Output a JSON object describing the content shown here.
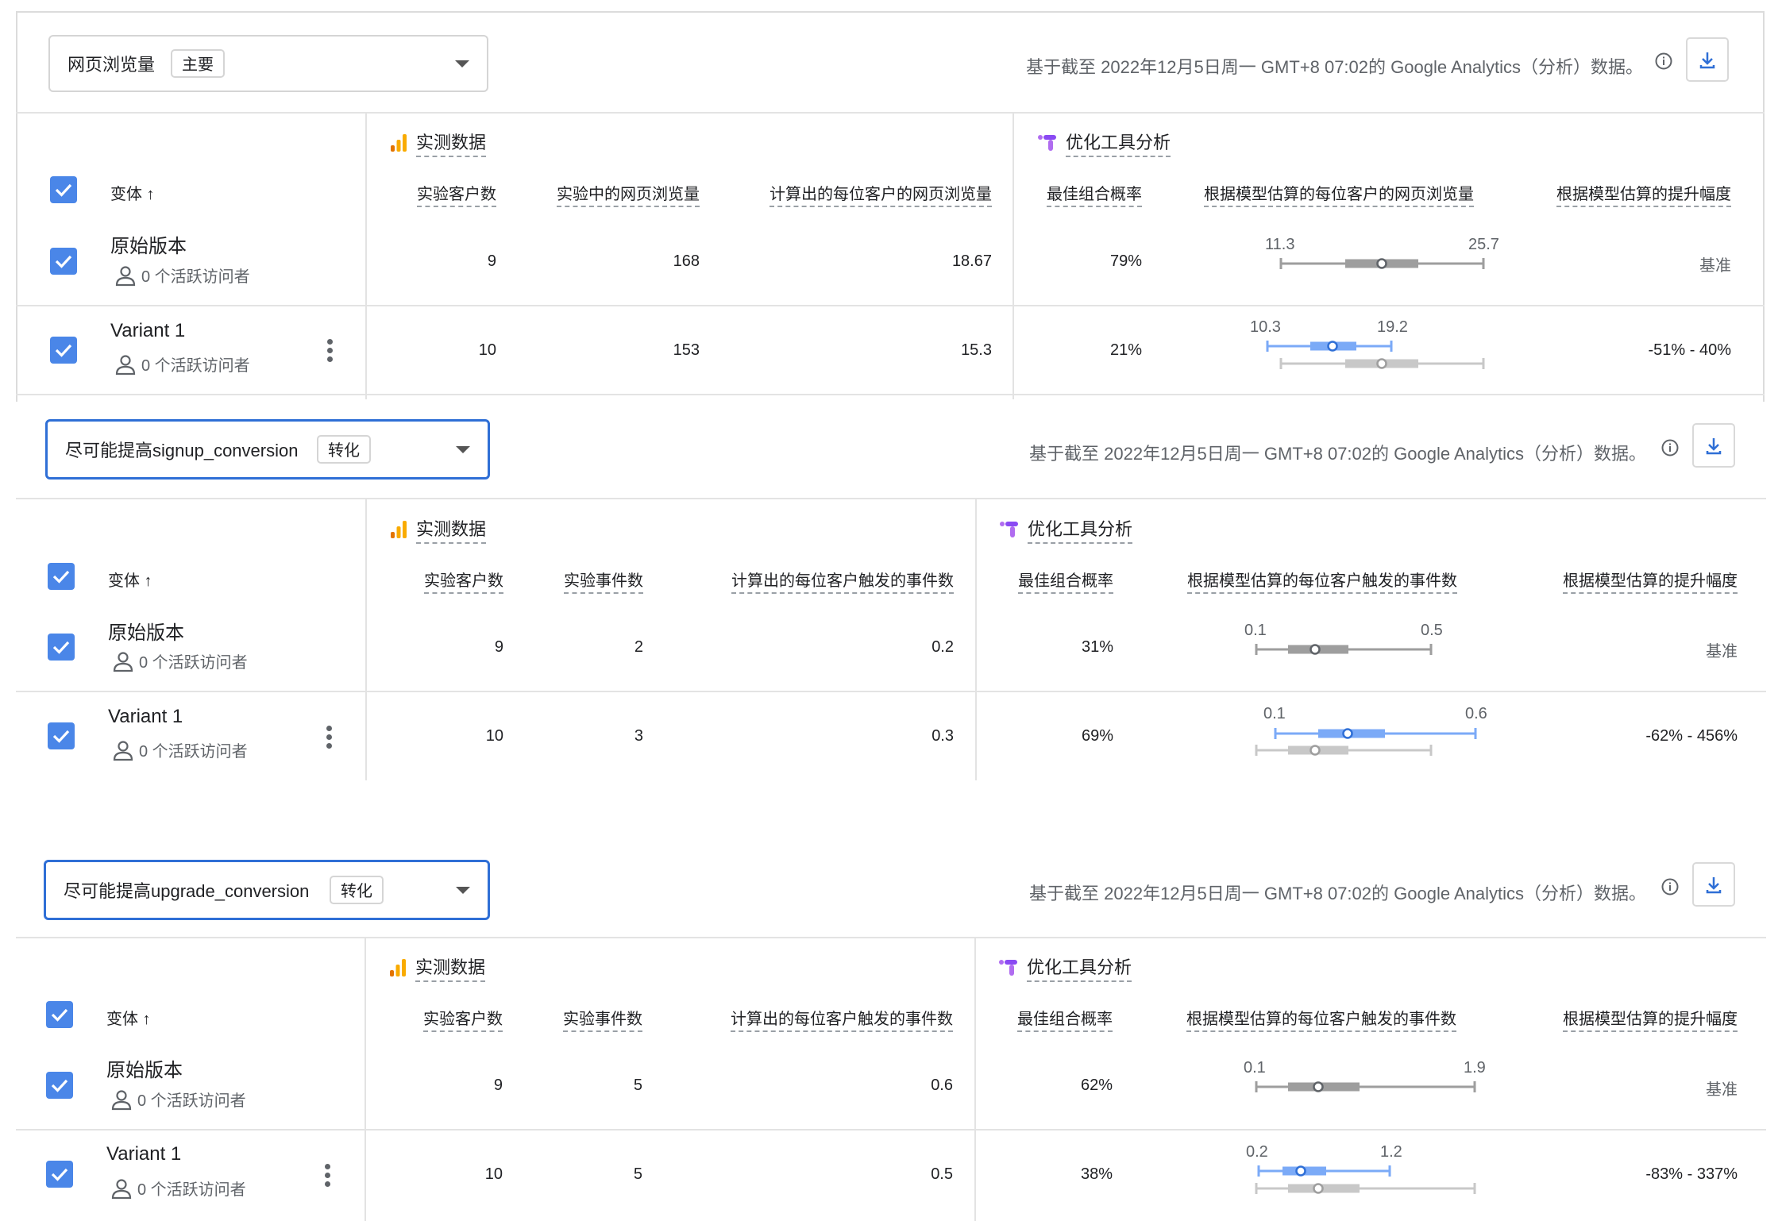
{
  "sections": [
    {
      "metric_label": "网页浏览量",
      "metric_tag": "主要",
      "as_of": "基于截至 2022年12月5日周一 GMT+8 07:02的 Google Analytics（分析）数据。",
      "group_observed": "实测数据",
      "group_optimize": "优化工具分析",
      "variant_header": "变体 ↑",
      "headers": [
        "实验客户数",
        "实验中的网页浏览量",
        "计算出的每位客户的网页浏览量",
        "最佳组合概率",
        "根据模型估算的每位客户的网页浏览量",
        "根据模型估算的提升幅度"
      ],
      "rows": [
        {
          "name": "原始版本",
          "visitors": "0 个活跃访问者",
          "users": "9",
          "count": "168",
          "rate": "18.67",
          "prob": "79%",
          "ci_low": "11.3",
          "ci_high": "25.7",
          "lift": "基准",
          "low": 11.3,
          "high": 25.7
        },
        {
          "name": "Variant 1",
          "visitors": "0 个活跃访问者",
          "users": "10",
          "count": "153",
          "rate": "15.3",
          "prob": "21%",
          "ci_low": "10.3",
          "ci_high": "19.2",
          "lift": "-51% - 40%",
          "low": 10.3,
          "high": 19.2
        }
      ]
    },
    {
      "metric_label": "尽可能提高signup_conversion",
      "metric_tag": "转化",
      "as_of": "基于截至 2022年12月5日周一 GMT+8 07:02的 Google Analytics（分析）数据。",
      "group_observed": "实测数据",
      "group_optimize": "优化工具分析",
      "variant_header": "变体 ↑",
      "headers": [
        "实验客户数",
        "实验事件数",
        "计算出的每位客户触发的事件数",
        "最佳组合概率",
        "根据模型估算的每位客户触发的事件数",
        "根据模型估算的提升幅度"
      ],
      "rows": [
        {
          "name": "原始版本",
          "visitors": "0 个活跃访问者",
          "users": "9",
          "count": "2",
          "rate": "0.2",
          "prob": "31%",
          "ci_low": "0.1",
          "ci_high": "0.5",
          "lift": "基准",
          "low": 0.1,
          "high": 0.5
        },
        {
          "name": "Variant 1",
          "visitors": "0 个活跃访问者",
          "users": "10",
          "count": "3",
          "rate": "0.3",
          "prob": "69%",
          "ci_low": "0.1",
          "ci_high": "0.6",
          "lift": "-62% - 456%",
          "low": 0.1,
          "high": 0.6
        }
      ]
    },
    {
      "metric_label": "尽可能提高upgrade_conversion",
      "metric_tag": "转化",
      "as_of": "基于截至 2022年12月5日周一 GMT+8 07:02的 Google Analytics（分析）数据。",
      "group_observed": "实测数据",
      "group_optimize": "优化工具分析",
      "variant_header": "变体 ↑",
      "headers": [
        "实验客户数",
        "实验事件数",
        "计算出的每位客户触发的事件数",
        "最佳组合概率",
        "根据模型估算的每位客户触发的事件数",
        "根据模型估算的提升幅度"
      ],
      "rows": [
        {
          "name": "原始版本",
          "visitors": "0 个活跃访问者",
          "users": "9",
          "count": "5",
          "rate": "0.6",
          "prob": "62%",
          "ci_low": "0.1",
          "ci_high": "1.9",
          "lift": "基准",
          "low": 0.1,
          "high": 1.9
        },
        {
          "name": "Variant 1",
          "visitors": "0 个活跃访问者",
          "users": "10",
          "count": "5",
          "rate": "0.5",
          "prob": "38%",
          "ci_low": "0.2",
          "ci_high": "1.2",
          "lift": "-83% - 337%",
          "low": 0.2,
          "high": 1.2
        }
      ]
    }
  ],
  "icons": {
    "info": "info-icon",
    "download": "download-icon",
    "analytics": "analytics-icon",
    "optimize": "optimize-icon",
    "user": "user-icon",
    "checkbox": "checkbox-icon",
    "dropdown": "dropdown-arrow-icon",
    "more": "more-vert-icon"
  },
  "colors": {
    "accent": "#4a86e8",
    "active_border": "#2f6fd6",
    "base_bar": "#9e9e9e",
    "variant_bar": "#4a86e8"
  }
}
